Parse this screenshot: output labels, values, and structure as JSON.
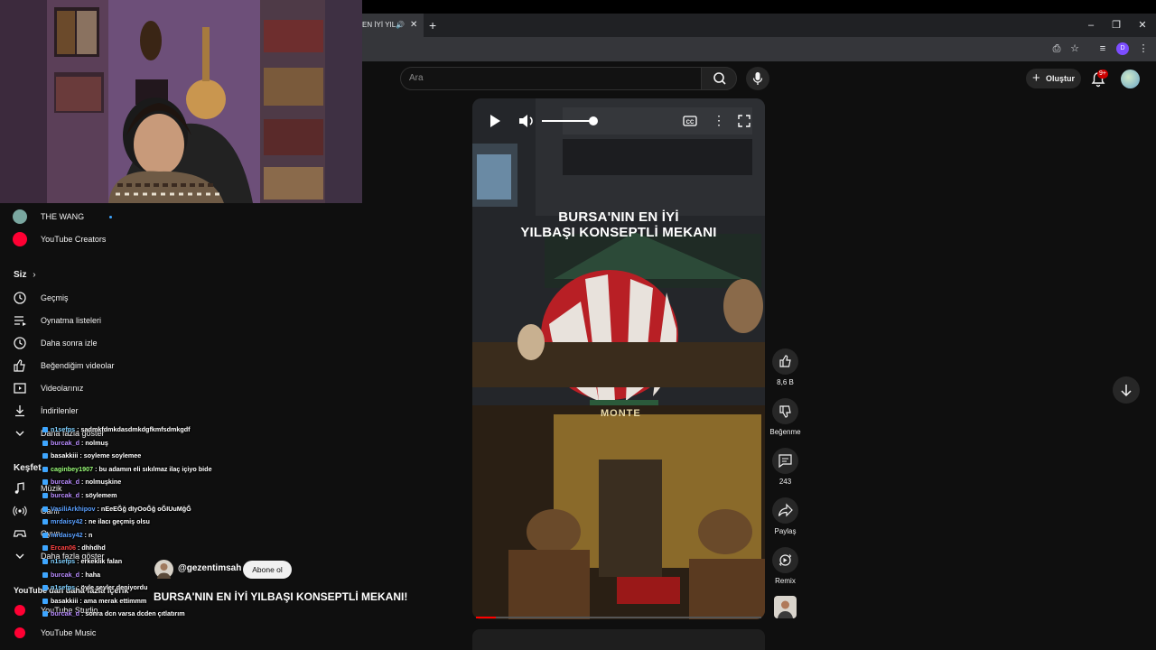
{
  "browser": {
    "tab_title": "EN İYİ YIL",
    "speaker_icon": "speaker-icon",
    "close_icon": "close-icon",
    "profile_initial": "D"
  },
  "header": {
    "search_placeholder": "Ara",
    "create_label": "Oluştur",
    "notification_count": "9+"
  },
  "sidebar": {
    "subscriptions": [
      {
        "label": "THE WANG",
        "icon": "channel-avatar-icon"
      },
      {
        "label": "YouTube Creators",
        "icon": "youtube-creators-icon"
      }
    ],
    "you_section": "Siz",
    "you_items": [
      {
        "label": "Geçmiş",
        "icon": "history-icon"
      },
      {
        "label": "Oynatma listeleri",
        "icon": "playlists-icon"
      },
      {
        "label": "Daha sonra izle",
        "icon": "clock-icon"
      },
      {
        "label": "Beğendiğim videolar",
        "icon": "thumbs-up-icon"
      },
      {
        "label": "Videolarınız",
        "icon": "your-videos-icon"
      },
      {
        "label": "İndirilenler",
        "icon": "download-icon"
      },
      {
        "label": "Daha fazla göster",
        "icon": "chevron-down-icon"
      }
    ],
    "explore_section": "Keşfet",
    "explore_items": [
      {
        "label": "Müzik",
        "icon": "music-icon"
      },
      {
        "label": "Canlı",
        "icon": "live-icon"
      },
      {
        "label": "Oyun",
        "icon": "gaming-icon"
      },
      {
        "label": "Daha fazla göster",
        "icon": "chevron-down-icon"
      }
    ],
    "more_section": "YouTube'dan daha fazla içerik",
    "more_items": [
      {
        "label": "YouTube Studio",
        "icon": "youtube-studio-icon"
      },
      {
        "label": "YouTube Music",
        "icon": "youtube-music-icon"
      }
    ]
  },
  "chat": [
    {
      "user": "n1sefps",
      "msg": "sadmkfdmkdasdmkdgfkmfsdmkgdf",
      "color": "#7fd0ff"
    },
    {
      "user": "burcak_d",
      "msg": "nolmuş",
      "color": "#b98cff"
    },
    {
      "user": "basakkiii",
      "msg": "soyleme soylemee",
      "color": "#ffffff"
    },
    {
      "user": "caginbey1907",
      "msg": "bu adamın eli sıkılmaz ilaç içiyo bide",
      "color": "#9cff7a"
    },
    {
      "user": "burcak_d",
      "msg": "nolmuşkine",
      "color": "#b98cff"
    },
    {
      "user": "burcak_d",
      "msg": "söylemem",
      "color": "#b98cff"
    },
    {
      "user": "VasiliArkhipov",
      "msg": "nEeEĞğ dIyOoĞğ oĞIUuMğĞ",
      "color": "#5aa0ff"
    },
    {
      "user": "mrdaisy42",
      "msg": "ne ilacı geçmiş olsu",
      "color": "#5aa0ff"
    },
    {
      "user": "mrdaisy42",
      "msg": "n",
      "color": "#5aa0ff"
    },
    {
      "user": "Ercan06",
      "msg": "dhhdhd",
      "color": "#ff4444"
    },
    {
      "user": "n1sefps",
      "msg": "erkeklik falan",
      "color": "#7fd0ff"
    },
    {
      "user": "burcak_d",
      "msg": "haha",
      "color": "#b98cff"
    },
    {
      "user": "n1sefps",
      "msg": "öyle şeyler deniyordu",
      "color": "#7fd0ff"
    },
    {
      "user": "basakkiii",
      "msg": "ama merak ettimmm",
      "color": "#ffffff"
    },
    {
      "user": "burcak_d",
      "msg": "sonra dcn varsa dcden çıtlatırım",
      "color": "#b98cff"
    }
  ],
  "video": {
    "overlay_title_line1": "BURSA'NIN EN İYİ",
    "overlay_title_line2": "YILBAŞI KONSEPTLİ MEKANI",
    "sign_text": "MONTE",
    "progress": 0.07,
    "volume": 0.95
  },
  "actions": {
    "likes": "8,6 B",
    "dislike_label": "Beğenme",
    "comments": "243",
    "share_label": "Paylaş",
    "remix_label": "Remix"
  },
  "channel": {
    "handle": "@gezentimsah",
    "subscribe_label": "Abone ol",
    "title": "BURSA'NIN EN İYİ YILBAŞI KONSEPTLİ MEKANI!"
  }
}
